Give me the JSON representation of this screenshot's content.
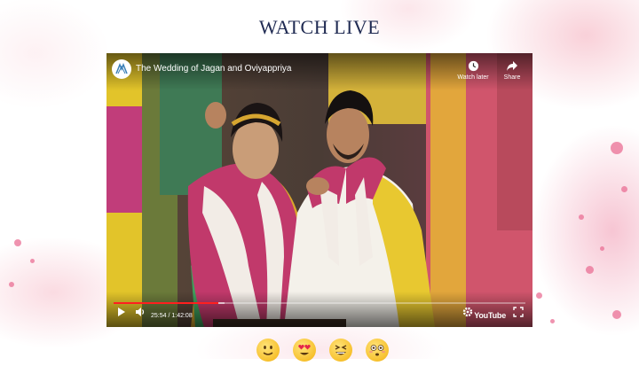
{
  "page": {
    "heading": "WATCH LIVE"
  },
  "video": {
    "title": "The Wedding of Jagan and Oviyappriya",
    "actions": {
      "watch_later": "Watch later",
      "share": "Share"
    },
    "player": {
      "current_time": "25:54",
      "duration": "1:42:08",
      "time_display": "25:54 / 1:42:08",
      "progress_fraction": 0.254,
      "buffered_fraction": 0.27,
      "brand": "YouTube"
    }
  },
  "reactions": [
    {
      "icon": "smiling-face-icon"
    },
    {
      "icon": "heart-eyes-face-icon"
    },
    {
      "icon": "grinning-squinting-face-icon"
    },
    {
      "icon": "flushed-face-icon"
    }
  ],
  "colors": {
    "heading": "#1f2a52",
    "progress": "#ff1f1f",
    "splash_pink": "#ea6f94"
  }
}
